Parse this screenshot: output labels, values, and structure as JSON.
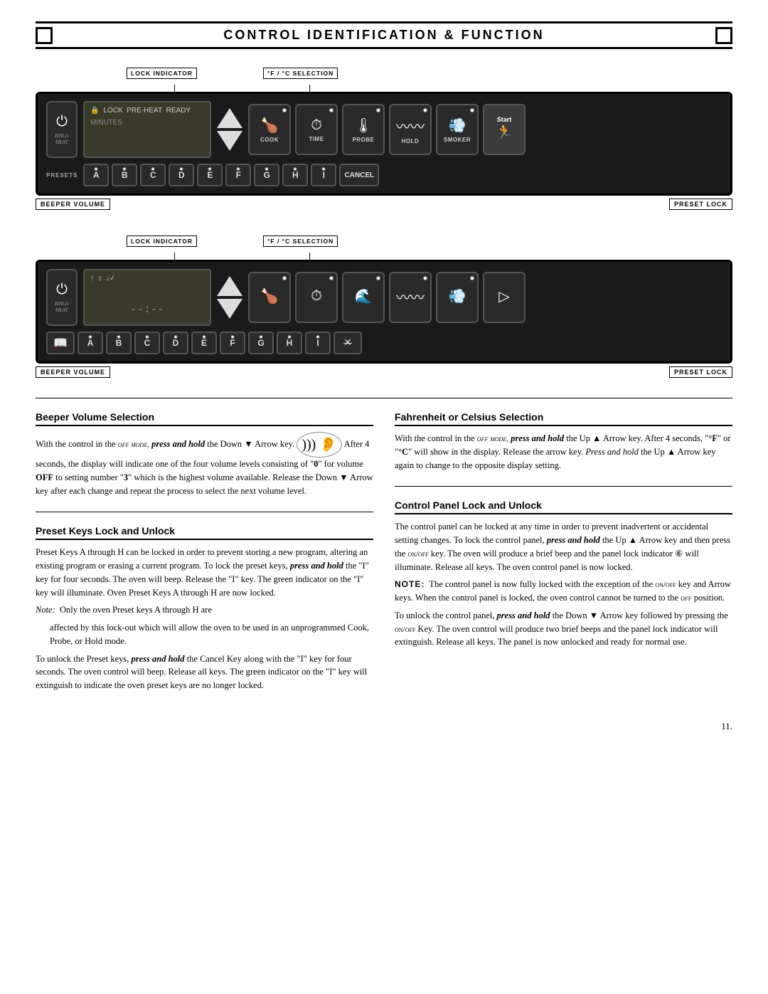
{
  "page": {
    "title": "CONTROL IDENTIFICATION & FUNCTION"
  },
  "diagrams": {
    "label_lock": "LOCK INDICATOR",
    "label_fahr": "°F / °C SELECTION",
    "label_beeper": "BEEPER VOLUME",
    "label_preset": "PRESET LOCK"
  },
  "panel1": {
    "display_line1": "🔒 LOCK  PRE-HEAT  READY",
    "display_minutes": "MINUTES",
    "halo_heat": "HALO HEAT",
    "buttons": [
      {
        "icon": "🍗",
        "label": "COOK"
      },
      {
        "icon": "⏱",
        "label": "TIME"
      },
      {
        "icon": "🌡",
        "label": "PROBE"
      },
      {
        "icon": "〰",
        "label": "HOLD"
      },
      {
        "icon": "💨",
        "label": "SMOKER"
      },
      {
        "icon": "▶",
        "label": "START"
      }
    ],
    "presets": [
      "A",
      "B",
      "C",
      "D",
      "E",
      "F",
      "G",
      "H",
      "I"
    ],
    "preset_label": "PRESETS",
    "cancel_label": "CANCEL"
  },
  "panel2": {
    "display_dashes": "--:--",
    "halo_heat": "HALO HEAT",
    "indicators": [
      "↑↕",
      "↓✓"
    ],
    "buttons": [
      {
        "icon": "🍗",
        "label": ""
      },
      {
        "icon": "⏱",
        "label": ""
      },
      {
        "icon": "🌊",
        "label": ""
      },
      {
        "icon": "〰",
        "label": ""
      },
      {
        "icon": "💨",
        "label": ""
      },
      {
        "icon": "▷",
        "label": ""
      }
    ],
    "presets": [
      "A",
      "B",
      "C",
      "D",
      "E",
      "F",
      "G",
      "H",
      "I"
    ],
    "preset_label": ""
  },
  "sections": {
    "beeper": {
      "title": "Beeper Volume Selection",
      "text": "With the control in the OFF mode, press and hold the Down ▼ Arrow key. After 4 seconds, the display will indicate one of the four volume levels consisting of \"0\" for volume OFF to setting number \"3\" which is the highest volume available. Release the Down ▼ Arrow key after each change and repeat the process to select the next volume level."
    },
    "preset_lock": {
      "title": "Preset Keys Lock and Unlock",
      "text1": "Preset Keys A through H can be locked in order to prevent storing a new program, altering an existing program or erasing a current program. To lock the preset keys, press and hold the \"I\" key for four seconds. The oven will beep. Release the \"I\" key. The green indicator on the \"I\" key will illuminate. Oven Preset Keys A through H are now locked.",
      "note_title": "Note:",
      "note": "Only the oven Preset keys A through H are affected by this lock-out which will allow the oven to be used in an unprogrammed Cook, Probe, or Hold mode.",
      "text2": "To unlock the Preset keys, press and hold the Cancel Key along with the \"I\" key for four seconds. The oven control will beep. Release all keys. The green indicator on the \"I\" key will extinguish to indicate the oven preset keys are no longer locked."
    },
    "fahrenheit": {
      "title": "Fahrenheit or Celsius Selection",
      "text": "With the control in the OFF mode, press and hold the Up ▲ Arrow key. After 4 seconds, \"°F\" or \"°C\" will show in the display. Release the arrow key. Press and hold the Up ▲ Arrow key again to change to the opposite display setting."
    },
    "control_lock": {
      "title": "Control Panel Lock and Unlock",
      "text1": "The control panel can be locked at any time in order to prevent inadvertent or accidental setting changes. To lock the control panel, press and hold the Up ▲ Arrow key and then press the ON/OFF key. The oven will produce a brief beep and the panel lock indicator ⑥ will illuminate. Release all keys. The oven control panel is now locked.",
      "note_label": "NOTE:",
      "note": "The control panel is now fully locked with the exception of the ON/OFF key and Arrow keys. When the control panel is locked, the oven control cannot be turned to the OFF position.",
      "text2": "To unlock the control panel, press and hold the Down ▼ Arrow key followed by pressing the ON/OFF Key. The oven control will produce two brief beeps and the panel lock indicator will extinguish. Release all keys. The panel is now unlocked and ready for normal use."
    }
  },
  "page_number": "11."
}
